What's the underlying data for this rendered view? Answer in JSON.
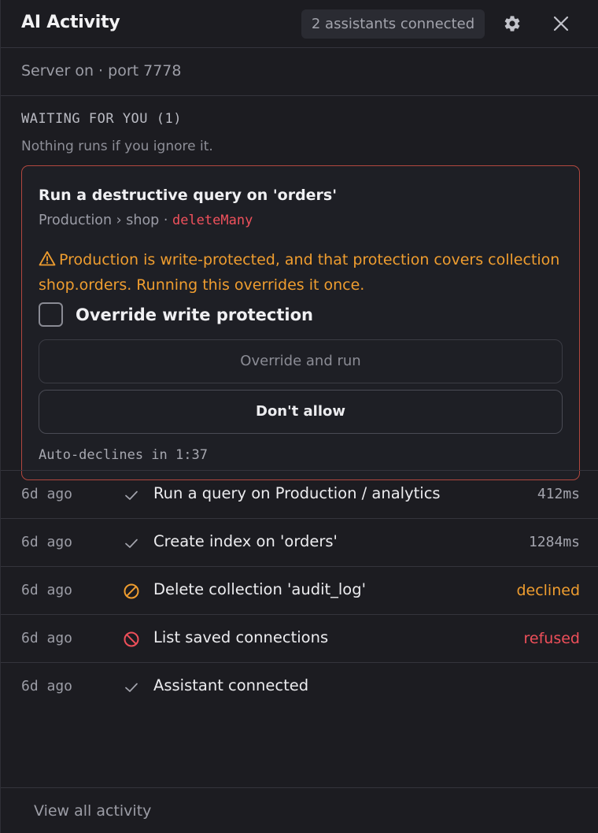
{
  "header": {
    "title": "AI Activity",
    "badge": "2 assistants connected",
    "settings_icon": "gear-icon",
    "close_icon": "close-icon"
  },
  "server_status": "Server on · port 7778",
  "waiting": {
    "title": "WAITING FOR YOU (1)",
    "subtitle": "Nothing runs if you ignore it."
  },
  "request": {
    "title": "Run a destructive query on 'orders'",
    "path": "Production › shop ·",
    "operation": "deleteMany",
    "warning": "Production is write-protected, and that protection covers collection shop.orders. Running this overrides it once.",
    "checkbox_label": "Override write protection",
    "checkbox_checked": false,
    "override_button": "Override and run",
    "deny_button": "Don't allow",
    "auto_decline": "Auto-declines in 1:37"
  },
  "activity": [
    {
      "time": "6d ago",
      "status": "check-icon",
      "label": "Run a query on Production / analytics",
      "meta": "412ms",
      "meta_kind": "duration"
    },
    {
      "time": "6d ago",
      "status": "check-icon",
      "label": "Create index on 'orders'",
      "meta": "1284ms",
      "meta_kind": "duration"
    },
    {
      "time": "6d ago",
      "status": "declined-icon",
      "label": "Delete collection 'audit_log'",
      "meta": "declined",
      "meta_kind": "declined"
    },
    {
      "time": "6d ago",
      "status": "refused-icon",
      "label": "List saved connections",
      "meta": "refused",
      "meta_kind": "refused"
    },
    {
      "time": "6d ago",
      "status": "check-icon",
      "label": "Assistant connected",
      "meta": "",
      "meta_kind": "none"
    }
  ],
  "footer": {
    "link": "View all activity"
  },
  "colors": {
    "warning": "#ef9d2f",
    "danger": "#ef4f5a",
    "card_border": "#b2483f",
    "background": "#1c1c21"
  }
}
